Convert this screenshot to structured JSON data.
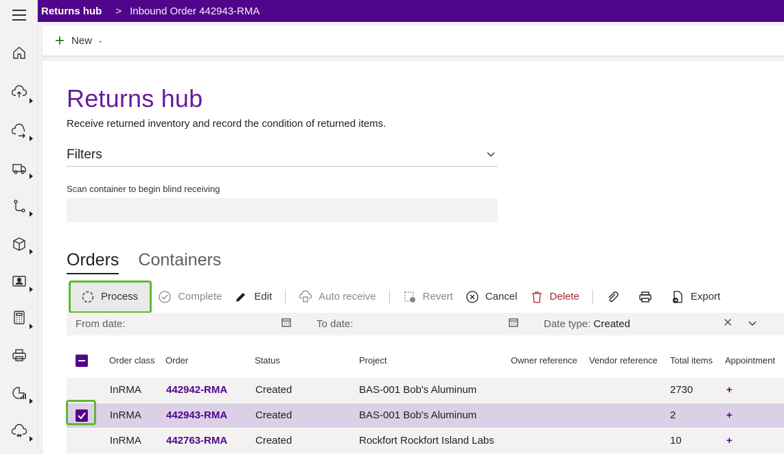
{
  "topbar": {
    "app_name": "Returns hub",
    "separator": ">",
    "breadcrumb": "Inbound Order 442943-RMA",
    "color": "#51058a"
  },
  "rail_icons": [
    "home-icon",
    "upload-icon",
    "transfer-icon",
    "truck-icon",
    "flow-icon",
    "package-icon",
    "contact-card-icon",
    "calculator-icon",
    "print-icon",
    "analytics-icon",
    "sync-icon"
  ],
  "command_bar": {
    "new_label": "New"
  },
  "page": {
    "title": "Returns hub",
    "subtitle": "Receive returned inventory and record the condition of returned items.",
    "filters_label": "Filters",
    "scan_label": "Scan container to begin blind receiving",
    "scan_value": ""
  },
  "tabs": [
    {
      "label": "Orders",
      "active": true
    },
    {
      "label": "Containers",
      "active": false
    }
  ],
  "toolbar": {
    "process": "Process",
    "complete": "Complete",
    "edit": "Edit",
    "auto_receive": "Auto receive",
    "revert": "Revert",
    "cancel": "Cancel",
    "delete": "Delete",
    "export": "Export"
  },
  "date_filters": {
    "from_label": "From date:",
    "to_label": "To date:",
    "date_type_label": "Date type:",
    "date_type_value": "Created"
  },
  "table": {
    "headers": [
      "Order class",
      "Order",
      "Status",
      "Project",
      "Owner reference",
      "Vendor reference",
      "Total items",
      "Appointment"
    ],
    "rows": [
      {
        "order_class": "InRMA",
        "order": "442942-RMA",
        "status": "Created",
        "project": "BAS-001 Bob's Aluminum",
        "owner_ref": "",
        "vendor_ref": "",
        "total_items": "2730",
        "appointment": "+",
        "selected": false
      },
      {
        "order_class": "InRMA",
        "order": "442943-RMA",
        "status": "Created",
        "project": "BAS-001 Bob's Aluminum",
        "owner_ref": "",
        "vendor_ref": "",
        "total_items": "2",
        "appointment": "+",
        "selected": true
      },
      {
        "order_class": "InRMA",
        "order": "442763-RMA",
        "status": "Created",
        "project": "Rockfort Rockfort Island Labs",
        "owner_ref": "",
        "vendor_ref": "",
        "total_items": "10",
        "appointment": "+",
        "selected": false
      }
    ]
  },
  "colors": {
    "accent": "#51058a",
    "title": "#6a1b9a",
    "highlight": "#5fb832",
    "danger": "#a4262c",
    "new_plus": "#107c10"
  }
}
